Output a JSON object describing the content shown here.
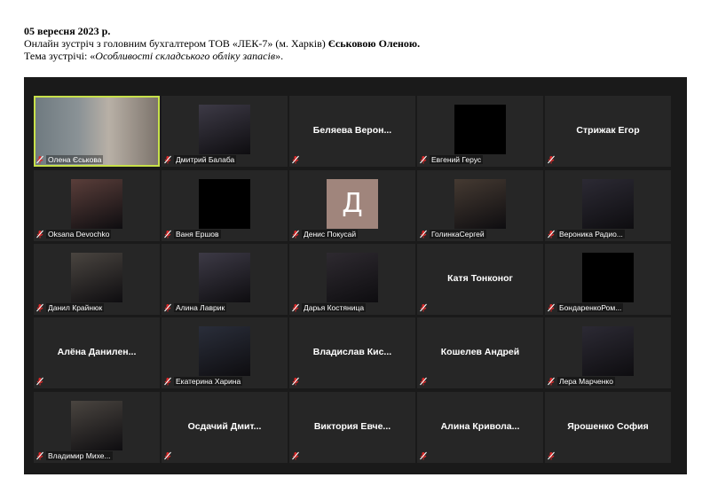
{
  "header": {
    "date": "05 вересня 2023 р.",
    "line2_prefix": "Онлайн зустріч з головним бухгалтером ТОВ «ЛЕК-7» (м. Харків) ",
    "line2_bold": "Єськовою Оленою.",
    "line3_prefix": "Тема зустрічі: «",
    "line3_italic": "Особливості складського обліку запасів",
    "line3_suffix": "»."
  },
  "participants": [
    {
      "name": "Олена Єськова",
      "style": "video-wide",
      "active": true
    },
    {
      "name": "Дмитрий Балаба",
      "style": "video"
    },
    {
      "name": "Беляева  Верон...",
      "style": "name-only"
    },
    {
      "name": "Евгений Герус",
      "style": "black"
    },
    {
      "name": "Стрижак Егор",
      "style": "name-only"
    },
    {
      "name": "Oksana Devochko",
      "style": "video"
    },
    {
      "name": "Ваня Ершов",
      "style": "black"
    },
    {
      "name": "Денис Покусай",
      "style": "initial",
      "initial": "Д"
    },
    {
      "name": "ГолинкаСергей",
      "style": "video"
    },
    {
      "name": "Вероника Радио...",
      "style": "video"
    },
    {
      "name": "Данил Крайнюк",
      "style": "video"
    },
    {
      "name": "Алина Лаврик",
      "style": "video"
    },
    {
      "name": "Дарья Костяница",
      "style": "video"
    },
    {
      "name": "Катя  Тонконог",
      "style": "name-only"
    },
    {
      "name": "БондаренкоРом...",
      "style": "black"
    },
    {
      "name": "Алёна  Данилен...",
      "style": "name-only"
    },
    {
      "name": "Екатерина Харина",
      "style": "video"
    },
    {
      "name": "Владислав  Кис...",
      "style": "name-only"
    },
    {
      "name": "Кошелев Андрей",
      "style": "name-only"
    },
    {
      "name": "Лера Марченко",
      "style": "video"
    },
    {
      "name": "Владимир Михе...",
      "style": "video"
    },
    {
      "name": "Осдачий  Дмит...",
      "style": "name-only"
    },
    {
      "name": "Виктория  Евче...",
      "style": "name-only"
    },
    {
      "name": "Алина  Кривола...",
      "style": "name-only"
    },
    {
      "name": "Ярошенко София",
      "style": "name-only"
    }
  ],
  "colors": {
    "active_outline": "#c7e04a",
    "mic_muted": "#e02828",
    "tile_bg": "#262626"
  }
}
